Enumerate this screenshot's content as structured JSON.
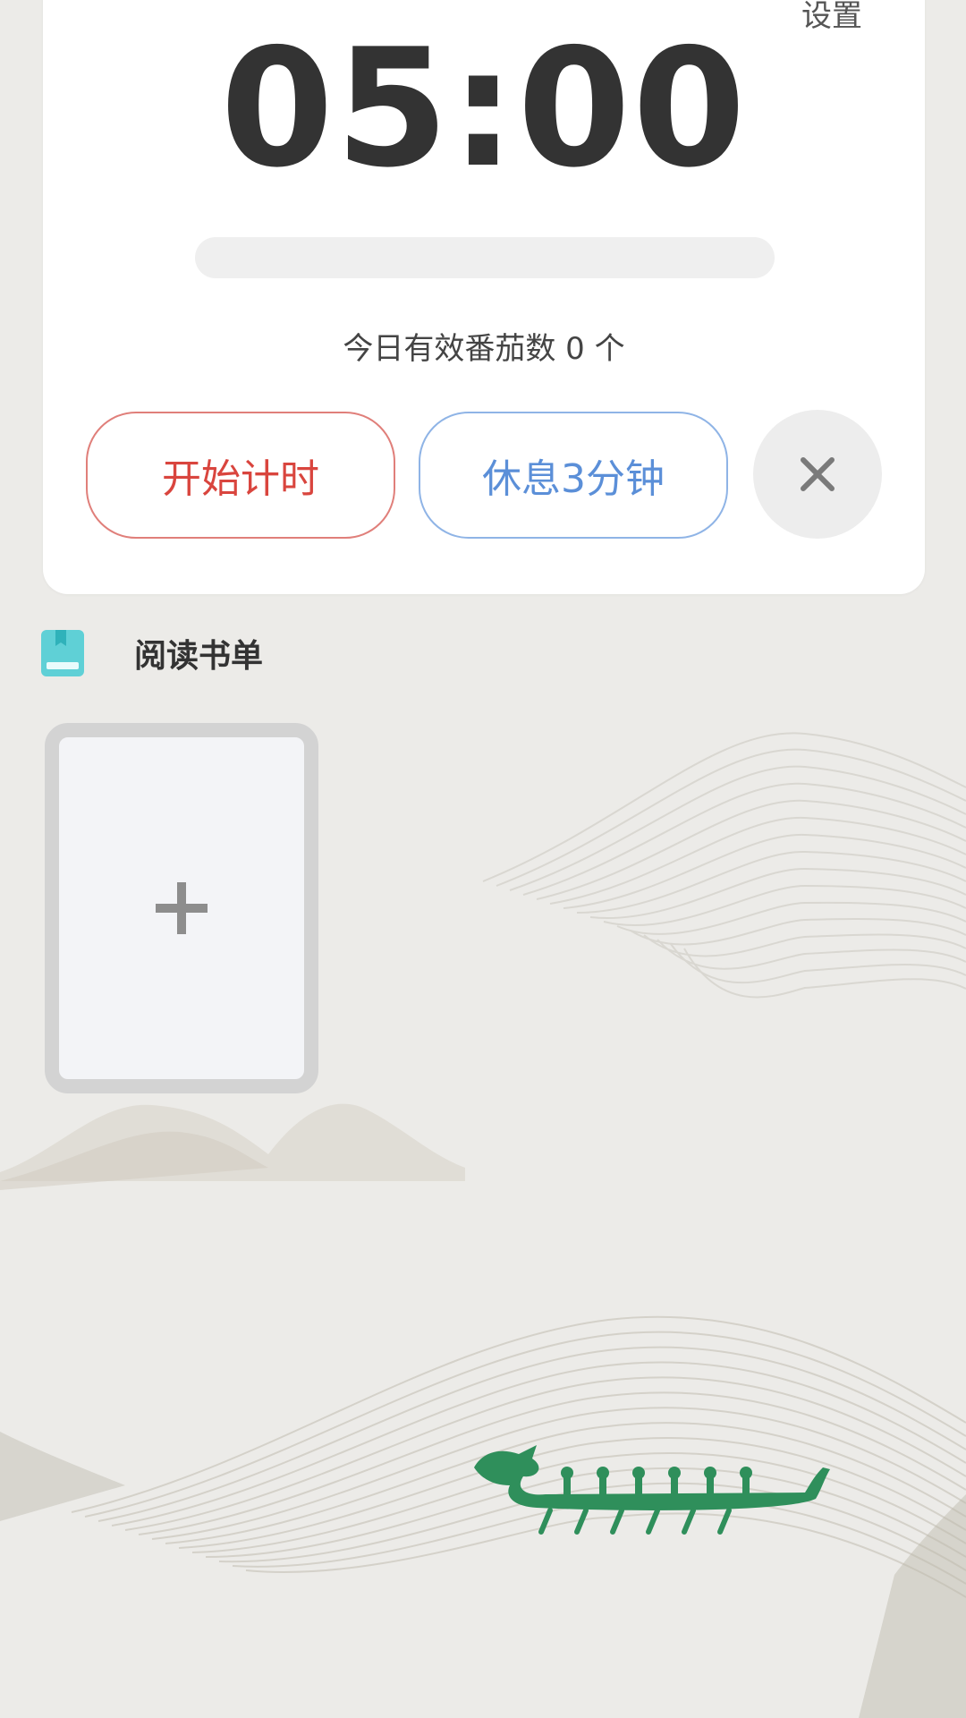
{
  "timer": {
    "top_right_partial_label": "设置",
    "time": "05:00",
    "progress_fraction": 0,
    "count_text": "今日有效番茄数 0 个",
    "start_label": "开始计时",
    "rest_label": "休息3分钟"
  },
  "reading": {
    "title": "阅读书单"
  },
  "icons": {
    "close": "close-icon",
    "book": "book-icon",
    "plus": "plus-icon"
  },
  "colors": {
    "start_red": "#d9453e",
    "rest_blue": "#5b8fd8",
    "dragon_green": "#2f8f5b",
    "book_icon": "#5fd0d6"
  }
}
